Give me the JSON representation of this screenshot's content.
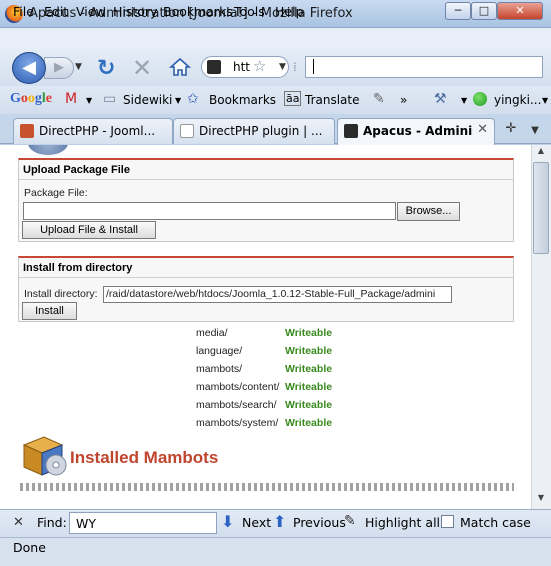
{
  "window": {
    "title": "Apacus - Administration [Joomla!] - Mozilla Firefox",
    "min": "─",
    "max": "□",
    "close": "✕"
  },
  "menu": [
    "File",
    "Edit",
    "View",
    "History",
    "Bookmarks",
    "Tools",
    "Help"
  ],
  "nav": {
    "url": "htt",
    "back_icon": "◀",
    "forward_icon": "▶"
  },
  "bookmarks_toolbar": {
    "google": "Google",
    "sidewiki": "Sidewiki",
    "bookmarks": "Bookmarks",
    "translate": "Translate",
    "more": "»",
    "user": "yingki..."
  },
  "tabs": [
    {
      "label": "DirectPHP - Jooml...",
      "active": false
    },
    {
      "label": "DirectPHP plugin | ...",
      "active": false
    },
    {
      "label": "Apacus - Adminis...",
      "active": true
    }
  ],
  "content": {
    "upload_panel": {
      "title": "Upload Package File",
      "label": "Package File:",
      "browse": "Browse...",
      "submit": "Upload File & Install"
    },
    "dir_panel": {
      "title": "Install from directory",
      "label": "Install directory:",
      "value": "/raid/datastore/web/htdocs/Joomla_1.0.12-Stable-Full_Package/admini",
      "submit": "Install"
    },
    "directories": [
      {
        "path": "media/",
        "status": "Writeable"
      },
      {
        "path": "language/",
        "status": "Writeable"
      },
      {
        "path": "mambots/",
        "status": "Writeable"
      },
      {
        "path": "mambots/content/",
        "status": "Writeable"
      },
      {
        "path": "mambots/search/",
        "status": "Writeable"
      },
      {
        "path": "mambots/system/",
        "status": "Writeable"
      }
    ],
    "section_title": "Installed Mambots"
  },
  "findbar": {
    "label": "Find:",
    "query": "WY",
    "next": "Next",
    "previous": "Previous",
    "highlight": "Highlight all",
    "match_case": "Match case"
  },
  "status": "Done"
}
